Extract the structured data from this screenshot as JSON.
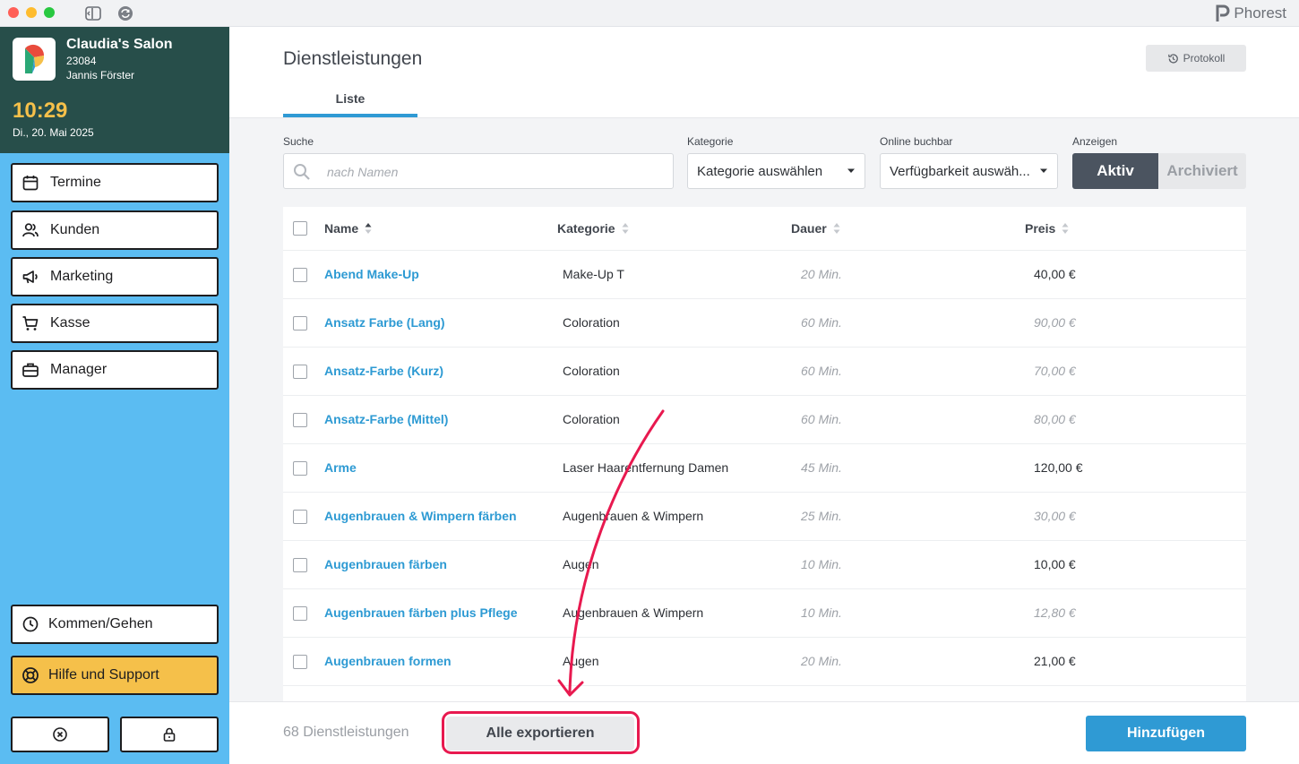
{
  "app": {
    "brand": "Phorest",
    "colors": {
      "accent": "#2f9ad4",
      "sidebar": "#5bbcf2",
      "header": "#274e4a",
      "clock": "#f5c04a",
      "highlight": "#e8194f"
    }
  },
  "sidebar": {
    "salon_name": "Claudia's Salon",
    "salon_id": "23084",
    "user": "Jannis Förster",
    "time": "10:29",
    "date": "Di., 20. Mai 2025",
    "nav": [
      {
        "label": "Termine",
        "icon": "calendar-icon"
      },
      {
        "label": "Kunden",
        "icon": "users-icon"
      },
      {
        "label": "Marketing",
        "icon": "megaphone-icon"
      },
      {
        "label": "Kasse",
        "icon": "cart-icon"
      },
      {
        "label": "Manager",
        "icon": "briefcase-icon"
      }
    ],
    "clock_in_label": "Kommen/Gehen",
    "help_label": "Hilfe und Support"
  },
  "main": {
    "title": "Dienstleistungen",
    "protocol_label": "Protokoll",
    "tab_label": "Liste"
  },
  "filters": {
    "search_label": "Suche",
    "search_placeholder": "nach Namen",
    "category_label": "Kategorie",
    "category_value": "Kategorie auswählen",
    "online_label": "Online buchbar",
    "online_value": "Verfügbarkeit auswäh...",
    "show_label": "Anzeigen",
    "active_label": "Aktiv",
    "archived_label": "Archiviert"
  },
  "table": {
    "columns": {
      "name": "Name",
      "category": "Kategorie",
      "duration": "Dauer",
      "price": "Preis"
    },
    "rows": [
      {
        "name": "Abend Make-Up",
        "category": "Make-Up T",
        "duration": "20 Min.",
        "price": "40,00 €",
        "muted": false
      },
      {
        "name": "Ansatz Farbe (Lang)",
        "category": "Coloration",
        "duration": "60 Min.",
        "price": "90,00 €",
        "muted": true
      },
      {
        "name": "Ansatz-Farbe (Kurz)",
        "category": "Coloration",
        "duration": "60 Min.",
        "price": "70,00 €",
        "muted": true
      },
      {
        "name": "Ansatz-Farbe (Mittel)",
        "category": "Coloration",
        "duration": "60 Min.",
        "price": "80,00 €",
        "muted": true
      },
      {
        "name": "Arme",
        "category": "Laser Haarentfernung Damen",
        "duration": "45 Min.",
        "price": "120,00 €",
        "muted": false
      },
      {
        "name": "Augenbrauen & Wimpern färben",
        "category": "Augenbrauen & Wimpern",
        "duration": "25 Min.",
        "price": "30,00 €",
        "muted": true
      },
      {
        "name": "Augenbrauen färben",
        "category": "Augen",
        "duration": "10 Min.",
        "price": "10,00 €",
        "muted": false
      },
      {
        "name": "Augenbrauen färben plus Pflege",
        "category": "Augenbrauen & Wimpern",
        "duration": "10 Min.",
        "price": "12,80 €",
        "muted": true
      },
      {
        "name": "Augenbrauen formen",
        "category": "Augen",
        "duration": "20 Min.",
        "price": "21,00 €",
        "muted": false
      }
    ]
  },
  "footer": {
    "count": "68 Dienstleistungen",
    "export_label": "Alle exportieren",
    "add_label": "Hinzufügen"
  }
}
